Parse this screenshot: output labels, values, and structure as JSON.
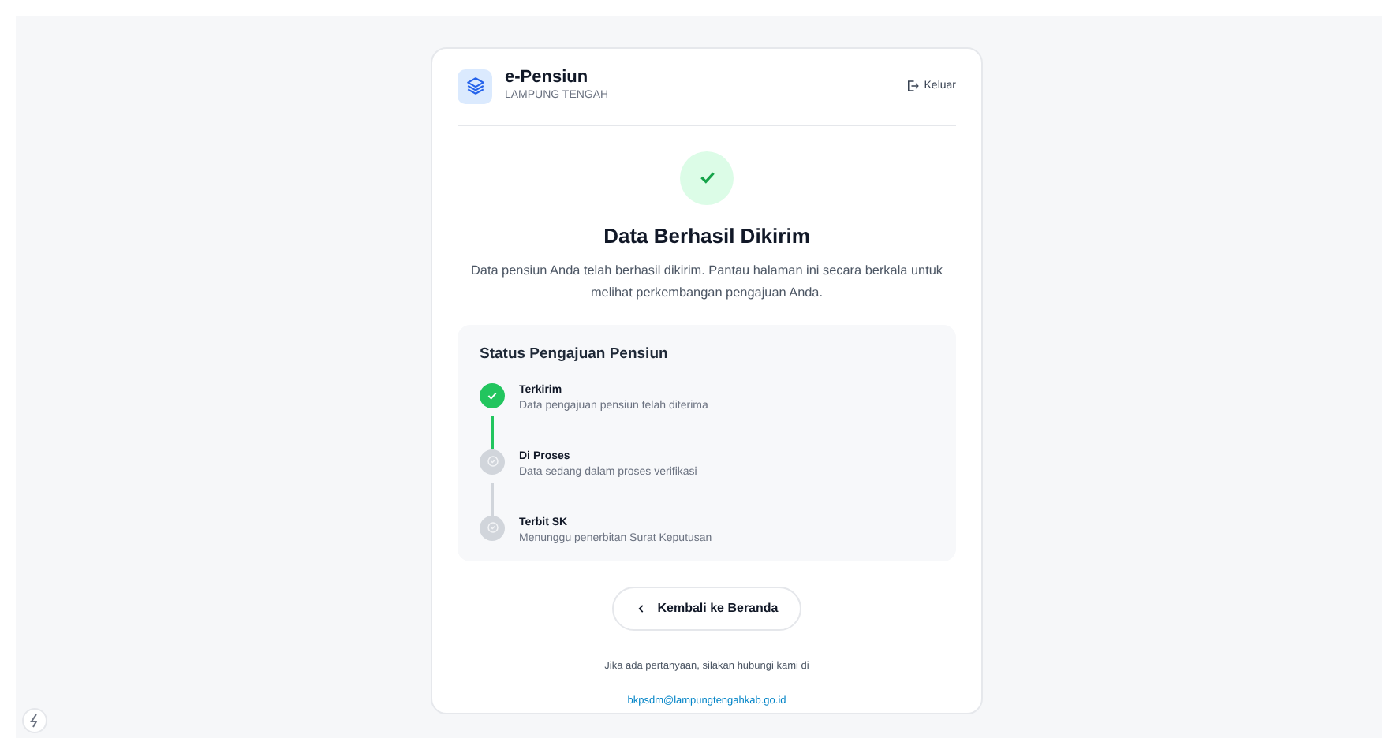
{
  "header": {
    "app_name": "e-Pensiun",
    "region": "LAMPUNG TENGAH",
    "logout": "Keluar"
  },
  "result": {
    "title": "Data Berhasil Dikirim",
    "message": "Data pensiun Anda telah berhasil dikirim. Pantau halaman ini secara berkala untuk melihat perkembangan pengajuan Anda."
  },
  "status": {
    "title": "Status Pengajuan Pensiun",
    "steps": [
      {
        "label": "Terkirim",
        "description": "Data pengajuan pensiun telah diterima",
        "done": true
      },
      {
        "label": "Di Proses",
        "description": "Data sedang dalam proses verifikasi",
        "done": false
      },
      {
        "label": "Terbit SK",
        "description": "Menunggu penerbitan Surat Keputusan",
        "done": false
      }
    ]
  },
  "back_button": "Kembali ke Beranda",
  "contact": {
    "text": "Jika ada pertanyaan, silakan hubungi kami di",
    "email": "bkpsdm@lampungtengahkab.go.id"
  }
}
